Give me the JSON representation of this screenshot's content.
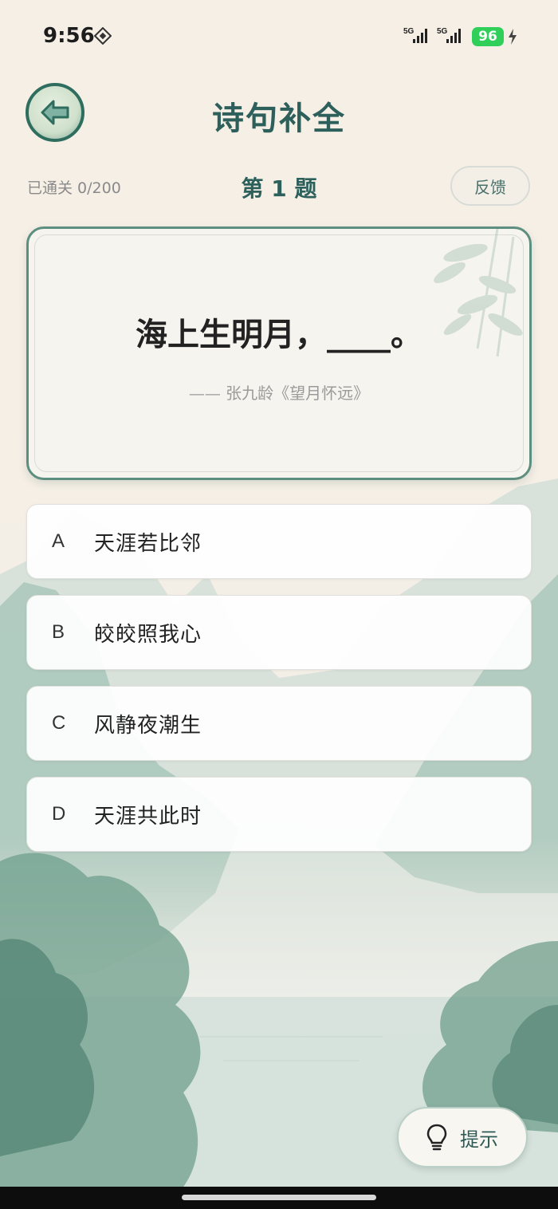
{
  "status_bar": {
    "time": "9:56",
    "network_1": "5G",
    "network_2": "5G",
    "battery": "96"
  },
  "header": {
    "title": "诗句补全"
  },
  "info": {
    "progress": "已通关 0/200",
    "question_number": "第 1 题",
    "feedback_label": "反馈"
  },
  "question": {
    "verse": "海上生明月，____。",
    "source": "—— 张九龄《望月怀远》"
  },
  "options": [
    {
      "letter": "A",
      "text": "天涯若比邻"
    },
    {
      "letter": "B",
      "text": "皎皎照我心"
    },
    {
      "letter": "C",
      "text": "风静夜潮生"
    },
    {
      "letter": "D",
      "text": "天涯共此时"
    }
  ],
  "hint": {
    "label": "提示"
  },
  "colors": {
    "accent": "#2d5f5b",
    "border": "#5d8f80",
    "battery": "#2fcf59"
  },
  "icons": {
    "back": "arrow-left-icon",
    "hint": "lightbulb-icon",
    "decoration": "bamboo-icon"
  }
}
